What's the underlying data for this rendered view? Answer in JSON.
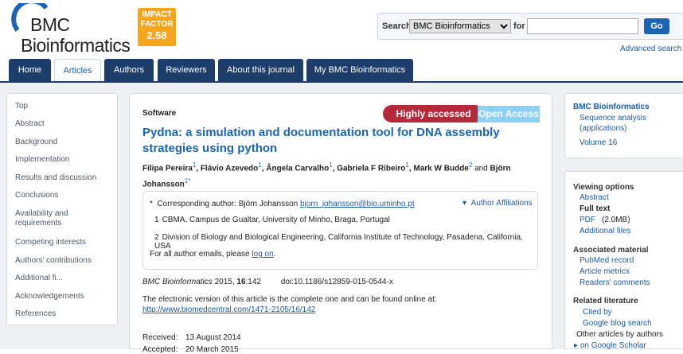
{
  "brand": {
    "line1": "BMC",
    "line2": "Bioinformatics",
    "impact_label": "IMPACT FACTOR",
    "impact_value": "2.58"
  },
  "search": {
    "label": "Search",
    "selected": "BMC Bioinformatics",
    "for_label": "for",
    "go": "Go",
    "advanced": "Advanced search"
  },
  "nav": {
    "tabs": [
      "Home",
      "Articles",
      "Authors",
      "Reviewers",
      "About this journal",
      "My BMC Bioinformatics"
    ],
    "active": "Articles"
  },
  "sidebar": {
    "items": [
      "Top",
      "Abstract",
      "Background",
      "Implementation",
      "Results and discussion",
      "Conclusions",
      "Availability and requirements",
      "Competing interests",
      "Authors' contributions",
      "Additional fi...",
      "Acknowledgements",
      "References"
    ]
  },
  "article": {
    "section": "Software",
    "badge_highly": "Highly accessed",
    "badge_open": "Open Access",
    "title": "Pydna: a simulation and documentation tool for DNA assembly strategies using python",
    "authors": [
      {
        "name": "Filipa Pereira",
        "sup": "1"
      },
      {
        "name": "Flávio Azevedo",
        "sup": "1"
      },
      {
        "name": "Ângela Carvalho",
        "sup": "1"
      },
      {
        "name": "Gabriela F Ribeiro",
        "sup": "1"
      },
      {
        "name": "Mark W Budde",
        "sup": "2"
      },
      {
        "name": "Björn Johansson",
        "sup": "1*"
      }
    ],
    "and": "and",
    "corr_prefix": "Corresponding author: Björn Johansson",
    "corr_email": "bjorn_johansson@bio.uminho.pt",
    "affil_toggle": "Author Affiliations",
    "affiliations": [
      {
        "n": "1",
        "text": "CBMA, Campus de Gualtar, University of Minho, Braga, Portugal"
      },
      {
        "n": "2",
        "text": "Division of Biology and Biological Engineering, California Institute of Technology, Pasadena, California, USA"
      }
    ],
    "emails_prefix": "For all author emails, please",
    "emails_link": "log on",
    "emails_suffix": ".",
    "cite_journal": "BMC Bioinformatics",
    "cite_year": "2015,",
    "cite_vol": "16",
    "cite_page": ":142",
    "cite_doi": "doi:10.1186/s12859-015-0544-x",
    "electronic_text": "The electronic version of this article is the complete one and can be found online at:",
    "electronic_url": "http://www.biomedcentral.com/1471-2105/16/142",
    "received_label": "Received:",
    "received_date": "13 August 2014",
    "accepted_label": "Accepted:",
    "accepted_date": "20 March 2015"
  },
  "right": {
    "journal": "BMC Bioinformatics",
    "section_line1": "Sequence analysis",
    "section_line2": "(applications)",
    "volume": "Volume 16",
    "viewing_title": "Viewing options",
    "abstract": "Abstract",
    "full_text": "Full text",
    "pdf": "PDF",
    "pdf_size": "(2.0MB)",
    "additional_files": "Additional files",
    "assoc_title": "Associated material",
    "pubmed": "PubMed record",
    "metrics": "Article metrics",
    "comments": "Readers' comments",
    "related_title": "Related literature",
    "cited_by": "Cited by",
    "google_blog": "Google blog search",
    "other_articles": "Other articles by authors",
    "scholar": "on Google Scholar"
  }
}
